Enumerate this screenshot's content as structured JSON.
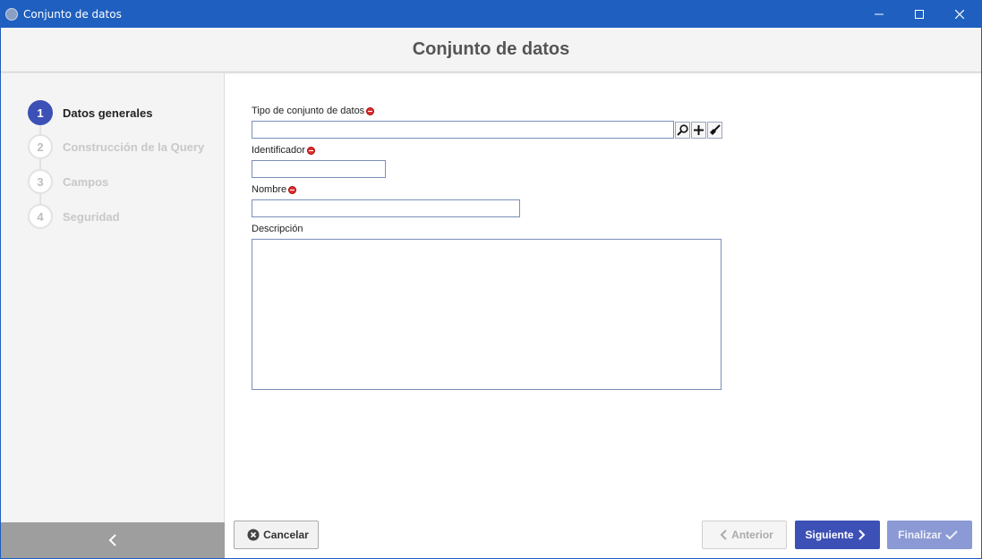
{
  "window": {
    "title": "Conjunto de datos"
  },
  "header": {
    "title": "Conjunto de datos"
  },
  "steps": [
    {
      "number": "1",
      "label": "Datos generales"
    },
    {
      "number": "2",
      "label": "Construcción de la Query"
    },
    {
      "number": "3",
      "label": "Campos"
    },
    {
      "number": "4",
      "label": "Seguridad"
    }
  ],
  "form": {
    "dataset_type_label": "Tipo de conjunto de datos",
    "dataset_type_value": "",
    "identifier_label": "Identificador",
    "identifier_value": "",
    "name_label": "Nombre",
    "name_value": "",
    "description_label": "Descripción",
    "description_value": ""
  },
  "footer": {
    "cancel_label": "Cancelar",
    "previous_label": "Anterior",
    "next_label": "Siguiente",
    "finish_label": "Finalizar"
  },
  "colors": {
    "titlebar": "#1f5fbf",
    "accent": "#3d50b5",
    "finish_disabled": "#8b99d4",
    "required": "#dd3333"
  }
}
